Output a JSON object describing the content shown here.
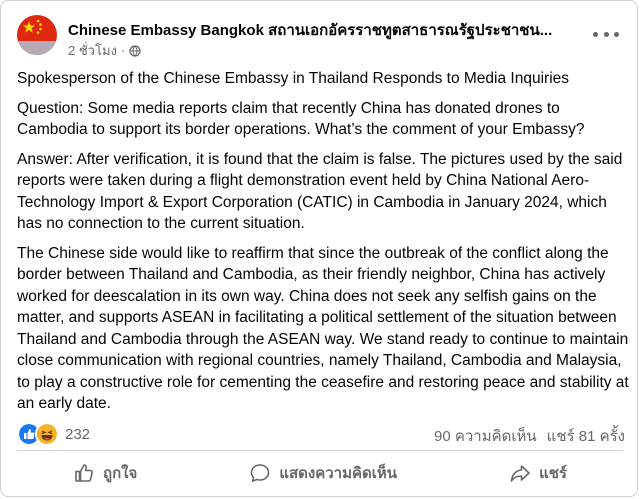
{
  "post": {
    "page_name": "Chinese Embassy Bangkok สถานเอกอัครราชทูตสาธารณรัฐประชาชน...",
    "time": "2 ชั่วโมง",
    "privacy_icon": "globe-icon",
    "paragraphs": [
      "Spokesperson of the Chinese Embassy in Thailand Responds to Media Inquiries",
      "Question: Some media reports claim that recently China has donated drones to Cambodia to support its border operations. What’s the comment of your Embassy?",
      "Answer: After verification, it is found that the claim is false. The pictures used by the said reports were taken during a flight demonstration event held by China National Aero-Technology Import & Export Corporation (CATIC) in Cambodia in January 2024, which has no connection to the current situation.",
      "The Chinese side would like to reaffirm that since the outbreak of the conflict along the border between Thailand and Cambodia, as their friendly neighbor, China has actively worked for deescalation in its own way.  China does not seek any selfish gains on the matter, and supports ASEAN in facilitating a political settlement of the situation between Thailand and Cambodia through the ASEAN way. We stand ready to continue to maintain close communication with regional countries, namely Thailand, Cambodia and Malaysia, to play a constructive role for cementing the ceasefire and restoring peace and stability at an early date."
    ]
  },
  "stats": {
    "reaction_count": "232",
    "comments": "90 ความคิดเห็น",
    "shares": "แชร์ 81 ครั้ง"
  },
  "actions": {
    "like": "ถูกใจ",
    "comment": "แสดงความคิดเห็น",
    "share": "แชร์"
  },
  "colors": {
    "like_blue": "#1877f2",
    "haha_yellow": "#f7b125",
    "flag_red": "#de2910",
    "flag_yellow": "#ffde00",
    "secondary_text": "#65676b"
  }
}
